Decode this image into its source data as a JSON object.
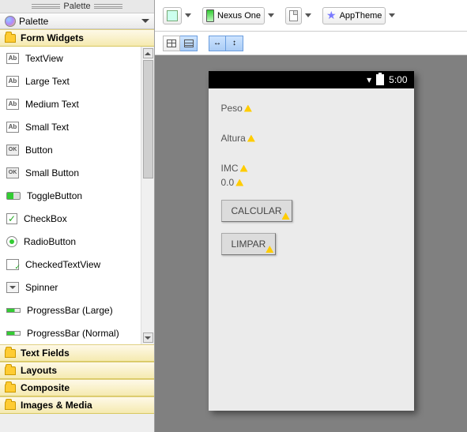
{
  "palette": {
    "title": "Palette",
    "subhead_label": "Palette",
    "categories": {
      "form_widgets": "Form Widgets",
      "text_fields": "Text Fields",
      "layouts": "Layouts",
      "composite": "Composite",
      "images_media": "Images & Media"
    },
    "form_widget_items": [
      {
        "id": "textview",
        "label": "TextView",
        "icon": "ab"
      },
      {
        "id": "large-text",
        "label": "Large Text",
        "icon": "ab"
      },
      {
        "id": "medium-text",
        "label": "Medium Text",
        "icon": "ab"
      },
      {
        "id": "small-text",
        "label": "Small Text",
        "icon": "ab"
      },
      {
        "id": "button",
        "label": "Button",
        "icon": "ok"
      },
      {
        "id": "small-button",
        "label": "Small Button",
        "icon": "ok"
      },
      {
        "id": "togglebutton",
        "label": "ToggleButton",
        "icon": "tog"
      },
      {
        "id": "checkbox",
        "label": "CheckBox",
        "icon": "chk"
      },
      {
        "id": "radiobutton",
        "label": "RadioButton",
        "icon": "rad"
      },
      {
        "id": "checkedtextview",
        "label": "CheckedTextView",
        "icon": "ctv"
      },
      {
        "id": "spinner",
        "label": "Spinner",
        "icon": "spn"
      },
      {
        "id": "progressbar-large",
        "label": "ProgressBar (Large)",
        "icon": "pb"
      },
      {
        "id": "progressbar-normal",
        "label": "ProgressBar (Normal)",
        "icon": "pb"
      }
    ]
  },
  "config_bar": {
    "device": "Nexus One",
    "theme": "AppTheme"
  },
  "preview": {
    "status_time": "5:00",
    "labels": {
      "peso": "Peso",
      "altura": "Altura",
      "imc": "IMC",
      "imc_value": "0.0"
    },
    "buttons": {
      "calcular": "CALCULAR",
      "limpar": "LIMPAR"
    }
  }
}
